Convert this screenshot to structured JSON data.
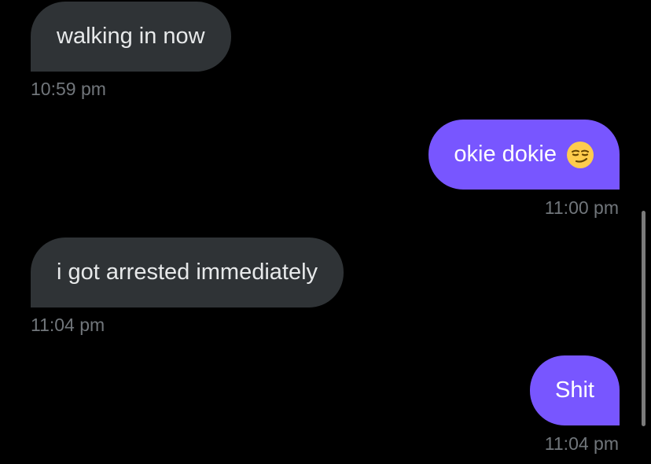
{
  "messages": [
    {
      "direction": "received",
      "text": "walking in now",
      "time": "10:59 pm"
    },
    {
      "direction": "sent",
      "text": "okie dokie",
      "emoji": "smirking-face-icon",
      "time": "11:00 pm"
    },
    {
      "direction": "received",
      "text": "i got arrested immediately",
      "time": "11:04 pm"
    },
    {
      "direction": "sent",
      "text": "Shit",
      "time": "11:04 pm"
    }
  ],
  "colors": {
    "background": "#000000",
    "received_bubble": "#2f3336",
    "sent_bubble": "#7856ff",
    "timestamp": "#71767b"
  }
}
